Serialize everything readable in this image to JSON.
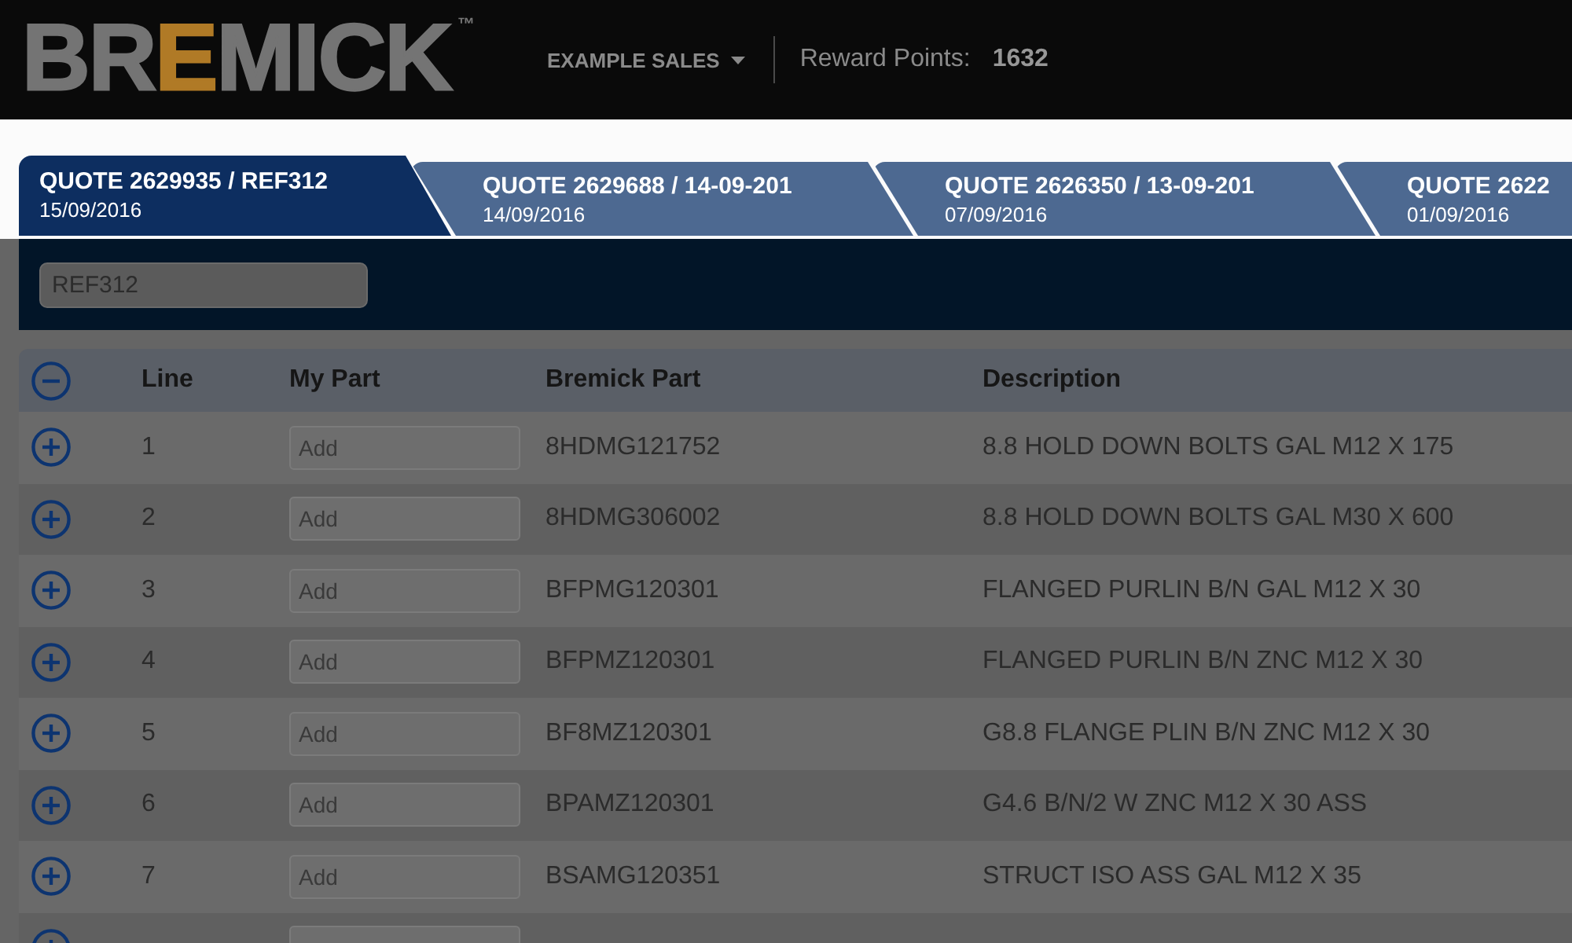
{
  "header": {
    "logo": {
      "lead": "BR",
      "accent": "E",
      "tail": "MICK",
      "trademark": "™"
    },
    "account_menu": {
      "label": "EXAMPLE SALES"
    },
    "reward_points": {
      "label": "Reward Points:",
      "value": "1632"
    }
  },
  "quote_tabs": [
    {
      "title": "QUOTE 2629935 / REF312",
      "date": "15/09/2016",
      "selected": true
    },
    {
      "title": "QUOTE 2629688 / 14-09-201",
      "date": "14/09/2016",
      "selected": false
    },
    {
      "title": "QUOTE 2626350 / 13-09-201",
      "date": "07/09/2016",
      "selected": false
    },
    {
      "title": "QUOTE 2622",
      "date": "01/09/2016",
      "selected": false
    }
  ],
  "reference_field": {
    "value": "REF312"
  },
  "table": {
    "columns": [
      "Line",
      "My Part",
      "Bremick Part",
      "Description"
    ],
    "all_expanded": true,
    "rows": [
      {
        "expanded": false,
        "line": "1",
        "my_part": {
          "placeholder": "Add"
        },
        "bremick_part": "8HDMG121752",
        "description": "8.8 HOLD DOWN BOLTS GAL M12 X 175"
      },
      {
        "expanded": false,
        "line": "2",
        "my_part": {
          "placeholder": "Add"
        },
        "bremick_part": "8HDMG306002",
        "description": "8.8 HOLD DOWN BOLTS GAL M30 X 600"
      },
      {
        "expanded": false,
        "line": "3",
        "my_part": {
          "placeholder": "Add"
        },
        "bremick_part": "BFPMG120301",
        "description": "FLANGED PURLIN B/N GAL M12 X 30"
      },
      {
        "expanded": false,
        "line": "4",
        "my_part": {
          "placeholder": "Add"
        },
        "bremick_part": "BFPMZ120301",
        "description": "FLANGED PURLIN B/N ZNC M12 X 30"
      },
      {
        "expanded": false,
        "line": "5",
        "my_part": {
          "placeholder": "Add"
        },
        "bremick_part": "BF8MZ120301",
        "description": "G8.8 FLANGE PLIN B/N ZNC M12 X 30"
      },
      {
        "expanded": false,
        "line": "6",
        "my_part": {
          "placeholder": "Add"
        },
        "bremick_part": "BPAMZ120301",
        "description": "G4.6 B/N/2 W ZNC M12 X 30 ASS"
      },
      {
        "expanded": false,
        "line": "7",
        "my_part": {
          "placeholder": "Add"
        },
        "bremick_part": "BSAMG120351",
        "description": "STRUCT ISO ASS GAL M12 X 35"
      },
      {
        "expanded": false
      }
    ]
  }
}
